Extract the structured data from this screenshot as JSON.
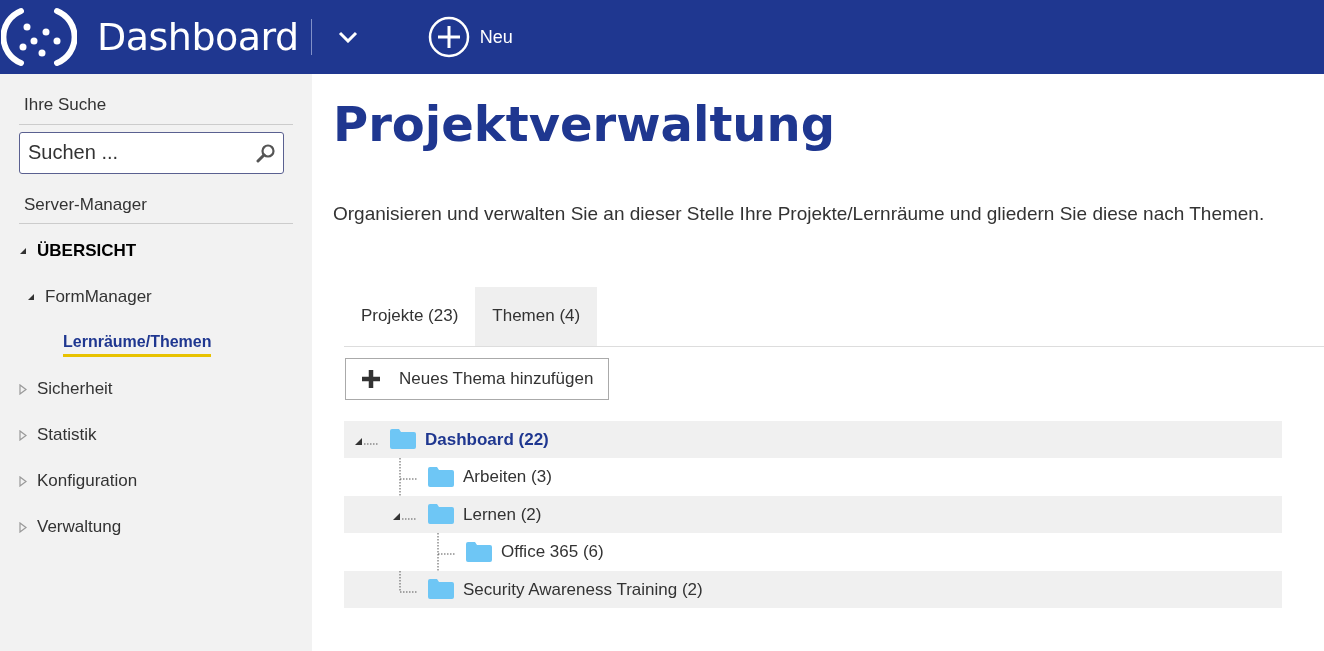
{
  "header": {
    "logo_text": "Dashboard",
    "new_button": "Neu"
  },
  "sidebar": {
    "search_label": "Ihre Suche",
    "search": {
      "placeholder": "Suchen ..."
    },
    "section_label": "Server-Manager",
    "items": [
      {
        "label": "ÜBERSICHT",
        "expanded": true,
        "selected": false,
        "children": [
          {
            "label": "FormManager",
            "expanded": true,
            "selected": false,
            "children": [
              {
                "label": "Lernräume/Themen",
                "selected": true
              }
            ]
          }
        ]
      },
      {
        "label": "Sicherheit",
        "expanded": false,
        "selected": false
      },
      {
        "label": "Statistik",
        "expanded": false,
        "selected": false
      },
      {
        "label": "Konfiguration",
        "expanded": false,
        "selected": false
      },
      {
        "label": "Verwaltung",
        "expanded": false,
        "selected": false
      }
    ]
  },
  "main": {
    "title": "Projektverwaltung",
    "description": "Organisieren und verwalten Sie an dieser Stelle Ihre Projekte/Lernräume und gliedern Sie diese nach Themen.",
    "tabs": [
      {
        "label": "Projekte (23)",
        "selected": false
      },
      {
        "label": "Themen (4)",
        "selected": true
      }
    ],
    "add_button": "Neues Thema hinzufügen",
    "tree": [
      {
        "label": "Dashboard (22)",
        "selected": true,
        "expanded": true,
        "children": [
          {
            "label": "Arbeiten (3)",
            "selected": false
          },
          {
            "label": "Lernen (2)",
            "selected": false,
            "expanded": true,
            "children": [
              {
                "label": "Office 365 (6)",
                "selected": false
              }
            ]
          },
          {
            "label": "Security Awareness Training (2)",
            "selected": false
          }
        ]
      }
    ]
  }
}
